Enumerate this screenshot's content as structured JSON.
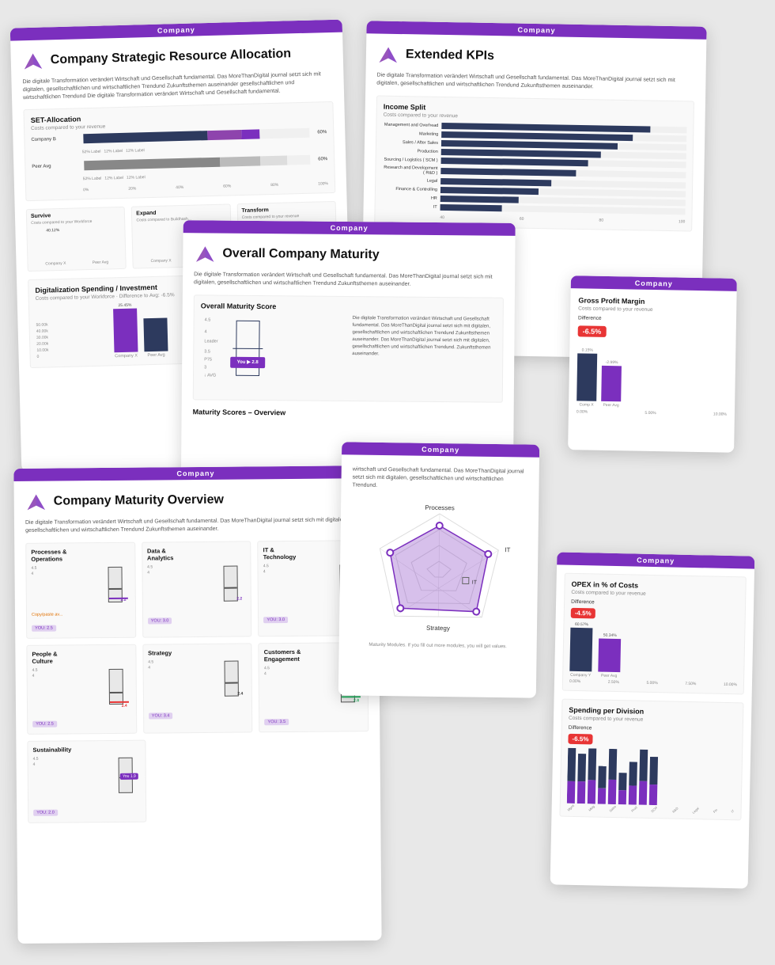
{
  "cards": {
    "card1": {
      "header": "Company",
      "title": "Company Strategic Resource Allocation",
      "subtitle": "Die digitale Transformation verändert Wirtschaft und Gesellschaft fundamental. Das MoreThanDigital journal setzt sich mit digitalen, gesellschaftlichen und wirtschaftlichen Trendund Zukunftsthemen auseinander gesellschaftlichen und wirtschaftlichen Trendund Die digitale Transformation verändert Wirtschaft und Gesellschaft fundamental.",
      "set_allocation": {
        "title": "SET-Allocation",
        "label": "Costs compared to your revenue",
        "rows": [
          {
            "label": "Company B",
            "survive": 60,
            "expand": 15,
            "transform": 5,
            "color1": "#2d3a5e",
            "color2": "#9b59b6",
            "color3": "#7b2fbe"
          },
          {
            "label": "Peer Avg",
            "survive": 55,
            "expand": 20,
            "transform": 10,
            "color1": "#888",
            "color2": "#bbb",
            "color3": "#ddd"
          }
        ]
      },
      "small_sections": [
        {
          "title": "Survive",
          "label": "Costs compared to your Workforce"
        },
        {
          "title": "Expand",
          "label": "Costs compared to Buildhasdhashashashashashashasha..."
        },
        {
          "title": "Transform",
          "label": "Costs compared to your revenue"
        }
      ],
      "digitalization": {
        "title": "Digitalization Spending / Investment",
        "label": "Costs compared to your Workforce  ·  Difference to Avg: -6.5%"
      }
    },
    "card2": {
      "header": "Company",
      "title": "Extended KPIs",
      "subtitle": "Die digitale Transformation verändert Wirtschaft und Gesellschaft fundamental. Das MoreThanDigital journal setzt sich mit digitalen, gesellschaftlichen und wirtschaftlichen Trendund Zukunftsthemen auseinander.",
      "income_split": {
        "title": "Income Split",
        "label": "Costs compared to your revenue",
        "rows": [
          {
            "label": "Management and Overhead",
            "val": 85
          },
          {
            "label": "Marketing",
            "val": 78
          },
          {
            "label": "Sales / After Sales",
            "val": 72
          },
          {
            "label": "Production",
            "val": 65
          },
          {
            "label": "Sourcing / Logistics (SCM)",
            "val": 60
          },
          {
            "label": "Research and Development (R&D)",
            "val": 55
          },
          {
            "label": "Legal",
            "val": 45
          },
          {
            "label": "Finance & Controlling",
            "val": 40
          },
          {
            "label": "HR",
            "val": 32
          },
          {
            "label": "IT",
            "val": 25
          }
        ]
      }
    },
    "card3": {
      "header": "Company",
      "title": "Overall Company Maturity",
      "subtitle": "Die digitale Transformation verändert Wirtschaft und Gesellschaft fundamental. Das MoreThanDigital journal setzt sich mit digitalen, gesellschaftlichen und wirtschaftlichen Trendund Zukunftsthemen auseinander.",
      "maturity_score": {
        "title": "Overall Maturity Score",
        "you_value": "2.8",
        "description": "Die digitale Transformation verändert Wirtschaft und Gesellschaft fundamental. Das MoreThanDigital journal setzt sich mit digitalen, gesellschaftlichen und wirtschaftlichen Trendund Zukunftsthemen auseinander. Das MoreThanDigital journal setzt sich mit digitalen, gesellschaftlichen und wirtschaftlichen Trendund. Zukunftsthemen auseinander."
      },
      "maturity_overview_title": "Maturity Scores – Overview"
    },
    "card4": {
      "header": "Company",
      "title": "Gross Profit Margin",
      "label": "Costs compared to your revenue",
      "difference_label": "Difference",
      "difference_value": "-6.5%"
    },
    "card5": {
      "header": "Company",
      "title": "Company Maturity Overview",
      "subtitle": "Die digitale Transformation verändert Wirtschaft und Gesellschaft fundamental. Das MoreThanDigital journal setzt sich mit digitalen, gesellschaftlichen und wirtschaftlichen Trendund Zukunftsthemen auseinander.",
      "sections": [
        {
          "title": "Processes &\nOperations",
          "you": "2.2",
          "peer": "YOU: 2.5",
          "note": "Copy/paste av..."
        },
        {
          "title": "Data &\nAnalytics",
          "you": "2.2",
          "peer": "YOU: 3.0"
        },
        {
          "title": "IT &\nTechnology",
          "you": "2.0",
          "peer": "YOU: 3.0"
        },
        {
          "title": "People &\nCulture",
          "you": "2.4",
          "peer": "YOU: 2.5"
        },
        {
          "title": "Strategy",
          "you": "2.4",
          "peer": "YOU: 3.4"
        },
        {
          "title": "Customers &\nEngagement",
          "you": "2.8",
          "peer": "YOU: 3.5"
        },
        {
          "title": "Sustainability",
          "you": "1.9",
          "peer": "YOU: 2.0"
        }
      ]
    },
    "card6": {
      "header": "Company",
      "subtitle": "wirtschaft und Gesellschaft fundamental. Das MoreThanDigital journal setzt sich mit digitalen, gesellschaftlichen und wirtschaftlichen Trendund.",
      "spider_labels": [
        "Processes",
        "IT",
        "Strategy"
      ],
      "note": "Maturity Modules. If you fill out more modules, you will get values."
    },
    "card7": {
      "opex": {
        "title": "OPEX in % of Costs",
        "label": "Costs compared to your revenue",
        "difference_label": "Difference",
        "difference_value": "-4.5%",
        "bar1": {
          "label": "Company Y",
          "val": 65,
          "pct": "60.57%"
        },
        "bar2": {
          "label": "Peer Avg",
          "val": 50,
          "pct": "50.34%"
        }
      },
      "spending": {
        "title": "Spending per Division",
        "label": "Costs compared to your revenue",
        "difference_label": "Difference",
        "difference_value": "-6.5%"
      }
    }
  }
}
